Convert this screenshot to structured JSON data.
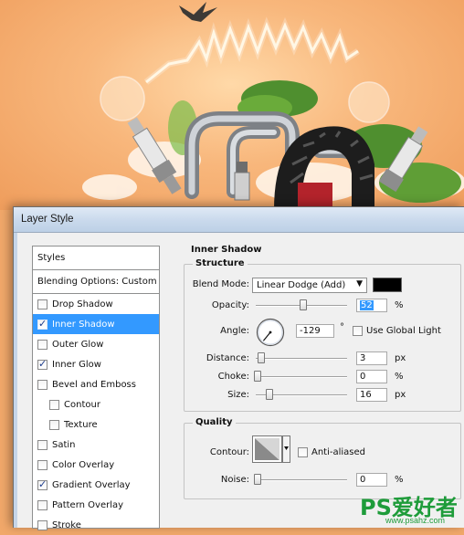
{
  "dialog": {
    "title": "Layer Style"
  },
  "styles_panel": {
    "header": "Styles",
    "blending": "Blending Options: Custom",
    "items": [
      {
        "label": "Drop Shadow",
        "checked": false,
        "selected": false,
        "indent": false
      },
      {
        "label": "Inner Shadow",
        "checked": true,
        "selected": true,
        "indent": false
      },
      {
        "label": "Outer Glow",
        "checked": false,
        "selected": false,
        "indent": false
      },
      {
        "label": "Inner Glow",
        "checked": true,
        "selected": false,
        "indent": false
      },
      {
        "label": "Bevel and Emboss",
        "checked": false,
        "selected": false,
        "indent": false
      },
      {
        "label": "Contour",
        "checked": false,
        "selected": false,
        "indent": true
      },
      {
        "label": "Texture",
        "checked": false,
        "selected": false,
        "indent": true
      },
      {
        "label": "Satin",
        "checked": false,
        "selected": false,
        "indent": false
      },
      {
        "label": "Color Overlay",
        "checked": false,
        "selected": false,
        "indent": false
      },
      {
        "label": "Gradient Overlay",
        "checked": true,
        "selected": false,
        "indent": false
      },
      {
        "label": "Pattern Overlay",
        "checked": false,
        "selected": false,
        "indent": false
      },
      {
        "label": "Stroke",
        "checked": false,
        "selected": false,
        "indent": false
      }
    ]
  },
  "inner_shadow": {
    "title": "Inner Shadow",
    "structure": {
      "title": "Structure",
      "blend_mode_label": "Blend Mode:",
      "blend_mode_value": "Linear Dodge (Add)",
      "color": "#000000",
      "opacity_label": "Opacity:",
      "opacity_value": "52",
      "opacity_unit": "%",
      "opacity_fraction": 0.52,
      "angle_label": "Angle:",
      "angle_value": "-129",
      "angle_unit": "°",
      "global_light_label": "Use Global Light",
      "global_light_checked": false,
      "distance_label": "Distance:",
      "distance_value": "3",
      "distance_unit": "px",
      "choke_label": "Choke:",
      "choke_value": "0",
      "choke_unit": "%",
      "size_label": "Size:",
      "size_value": "16",
      "size_unit": "px"
    },
    "quality": {
      "title": "Quality",
      "contour_label": "Contour:",
      "anti_aliased_label": "Anti-aliased",
      "anti_aliased_checked": false,
      "noise_label": "Noise:",
      "noise_value": "0",
      "noise_unit": "%"
    }
  },
  "watermark": {
    "main": "PS爱好者",
    "sub": "www.psahz.com"
  },
  "colors": {
    "selection": "#3399ff",
    "watermark": "#1e9c3a",
    "art_bg": "#f1a86a"
  }
}
